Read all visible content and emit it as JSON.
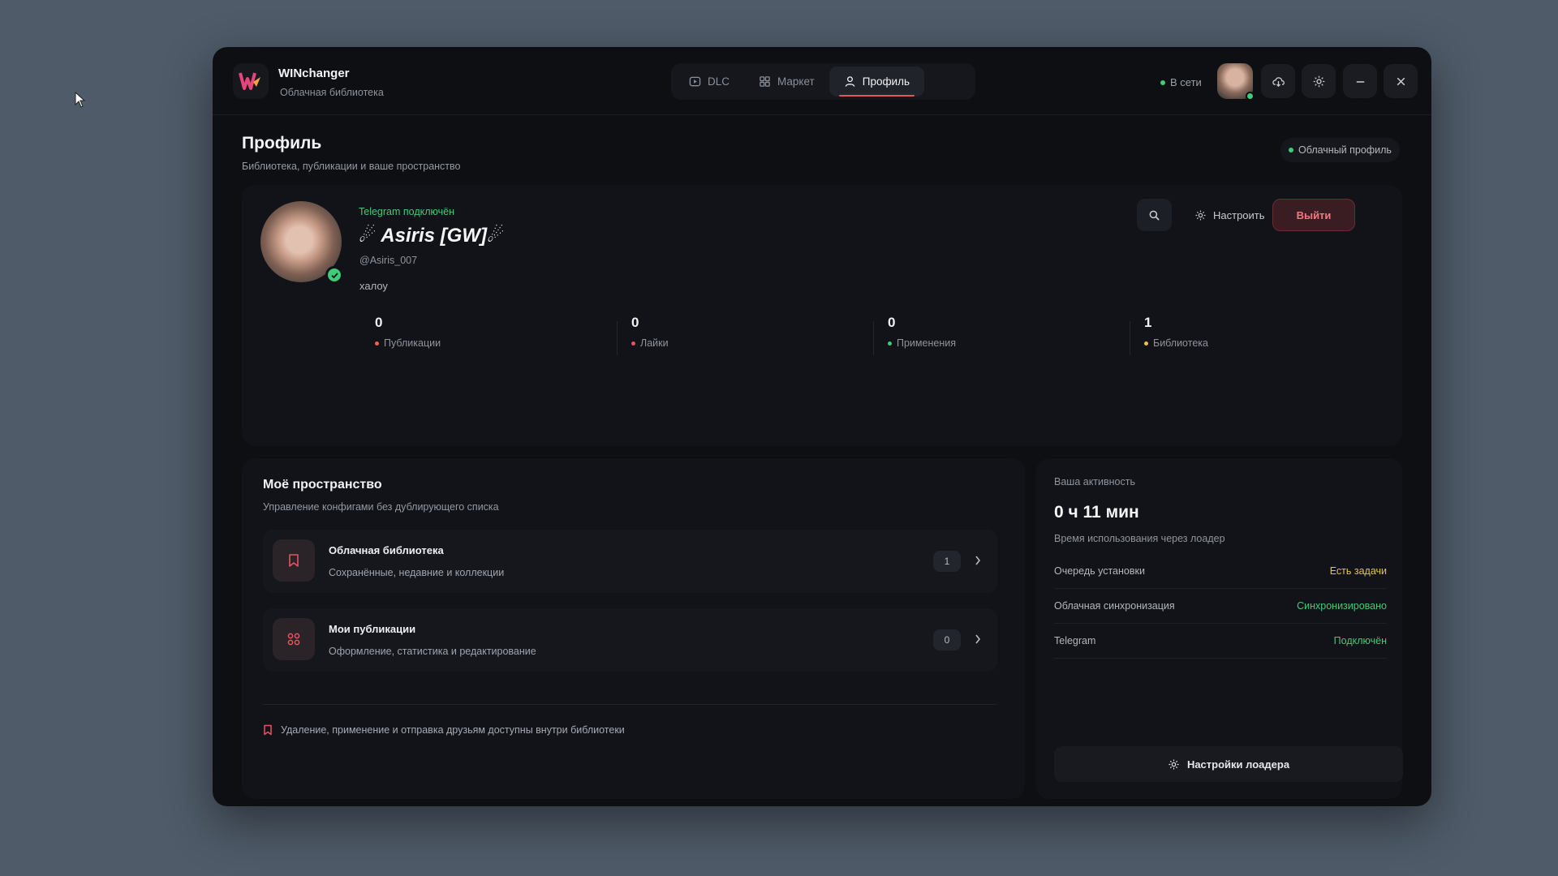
{
  "app": {
    "title": "WINchanger",
    "subtitle": "Облачная библиотека",
    "logo_text": "W"
  },
  "nav": {
    "tabs": [
      {
        "label": "DLC",
        "icon": "play-square-icon",
        "active": false
      },
      {
        "label": "Маркет",
        "icon": "grid-icon",
        "active": false
      },
      {
        "label": "Профиль",
        "icon": "user-icon",
        "active": true
      }
    ]
  },
  "status": {
    "online_label": "В сети"
  },
  "page": {
    "title": "Профиль",
    "subtitle": "Библиотека, публикации и ваше пространство",
    "cloud_profile": "Облачный профиль"
  },
  "profile": {
    "telegram_status": "Telegram подключён",
    "display_name": "☄ Asiris [GW]☄",
    "handle": "@Asiris_007",
    "bio": "халоу",
    "settings_label": "Настроить",
    "logout_label": "Выйти",
    "stats": [
      {
        "value": "0",
        "label": "Публикации",
        "color": "#e8654f"
      },
      {
        "value": "0",
        "label": "Лайки",
        "color": "#e5545e"
      },
      {
        "value": "0",
        "label": "Применения",
        "color": "#3ecb7a"
      },
      {
        "value": "1",
        "label": "Библиотека",
        "color": "#e8c24a"
      }
    ]
  },
  "space": {
    "title": "Моё пространство",
    "subtitle": "Управление конфигами без дублирующего списка",
    "items": [
      {
        "title": "Облачная библиотека",
        "subtitle": "Сохранённые, недавние и коллекции",
        "count": "1",
        "icon": "bookmark-icon"
      },
      {
        "title": "Мои публикации",
        "subtitle": "Оформление, статистика и редактирование",
        "count": "0",
        "icon": "grid-icon"
      }
    ],
    "note": "Удаление, применение и отправка друзьям доступны внутри библиотеки"
  },
  "activity": {
    "label": "Ваша активность",
    "time": "0 ч 11 мин",
    "subtitle": "Время использования через лоадер",
    "rows": [
      {
        "key": "Очередь установки",
        "value": "Есть задачи",
        "color": "#e8c24a"
      },
      {
        "key": "Облачная синхронизация",
        "value": "Синхронизировано",
        "color": "#43c979"
      },
      {
        "key": "Telegram",
        "value": "Подключён",
        "color": "#43c979"
      }
    ],
    "loader_settings": "Настройки лоадера"
  },
  "colors": {
    "accent": "#e5545e",
    "success": "#3ecb7a",
    "warning": "#e8c24a",
    "window_bg": "#0d0f13",
    "desktop_bg": "#4f5b69"
  }
}
